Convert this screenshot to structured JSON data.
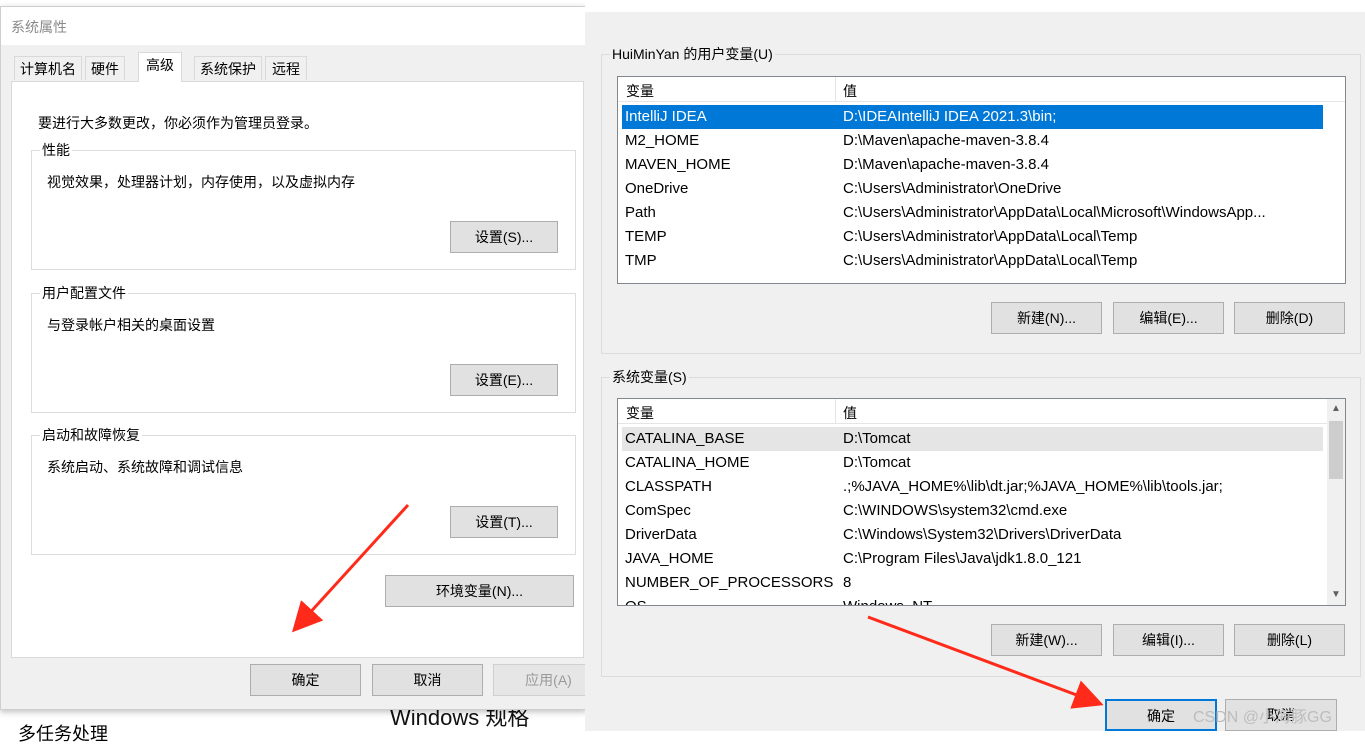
{
  "background": {
    "left_text": "多任务处理",
    "bottom_text": "Windows 规格"
  },
  "system_properties": {
    "title": "系统属性",
    "tabs": [
      "计算机名",
      "硬件",
      "高级",
      "系统保护",
      "远程"
    ],
    "active_tab": "高级",
    "admin_note": "要进行大多数更改，你必须作为管理员登录。",
    "performance": {
      "title": "性能",
      "desc": "视觉效果，处理器计划，内存使用，以及虚拟内存",
      "button": "设置(S)..."
    },
    "user_profiles": {
      "title": "用户配置文件",
      "desc": "与登录帐户相关的桌面设置",
      "button": "设置(E)..."
    },
    "startup_recovery": {
      "title": "启动和故障恢复",
      "desc": "系统启动、系统故障和调试信息",
      "button": "设置(T)..."
    },
    "env_button": "环境变量(N)...",
    "ok": "确定",
    "cancel": "取消",
    "apply": "应用(A)"
  },
  "env_vars": {
    "user_section_title": "HuiMinYan 的用户变量(U)",
    "system_section_title": "系统变量(S)",
    "col_variable": "变量",
    "col_value": "值",
    "user_vars": [
      {
        "k": "IntelliJ IDEA",
        "v": "D:\\IDEAIntelliJ IDEA 2021.3\\bin;"
      },
      {
        "k": "M2_HOME",
        "v": "D:\\Maven\\apache-maven-3.8.4"
      },
      {
        "k": "MAVEN_HOME",
        "v": "D:\\Maven\\apache-maven-3.8.4"
      },
      {
        "k": "OneDrive",
        "v": "C:\\Users\\Administrator\\OneDrive"
      },
      {
        "k": "Path",
        "v": "C:\\Users\\Administrator\\AppData\\Local\\Microsoft\\WindowsApp..."
      },
      {
        "k": "TEMP",
        "v": "C:\\Users\\Administrator\\AppData\\Local\\Temp"
      },
      {
        "k": "TMP",
        "v": "C:\\Users\\Administrator\\AppData\\Local\\Temp"
      }
    ],
    "system_vars": [
      {
        "k": "CATALINA_BASE",
        "v": "D:\\Tomcat"
      },
      {
        "k": "CATALINA_HOME",
        "v": "D:\\Tomcat"
      },
      {
        "k": "CLASSPATH",
        "v": ".;%JAVA_HOME%\\lib\\dt.jar;%JAVA_HOME%\\lib\\tools.jar;"
      },
      {
        "k": "ComSpec",
        "v": "C:\\WINDOWS\\system32\\cmd.exe"
      },
      {
        "k": "DriverData",
        "v": "C:\\Windows\\System32\\Drivers\\DriverData"
      },
      {
        "k": "JAVA_HOME",
        "v": "C:\\Program Files\\Java\\jdk1.8.0_121"
      },
      {
        "k": "NUMBER_OF_PROCESSORS",
        "v": "8"
      },
      {
        "k": "OS",
        "v": "Windows_NT"
      }
    ],
    "user_buttons": {
      "new": "新建(N)...",
      "edit": "编辑(E)...",
      "delete": "删除(D)"
    },
    "system_buttons": {
      "new": "新建(W)...",
      "edit": "编辑(I)...",
      "delete": "删除(L)"
    },
    "ok": "确定",
    "cancel": "取消"
  },
  "watermark": "CSDN @小海豚GG",
  "colors": {
    "selection": "#0078d7",
    "arrow": "#ff2a1a"
  }
}
